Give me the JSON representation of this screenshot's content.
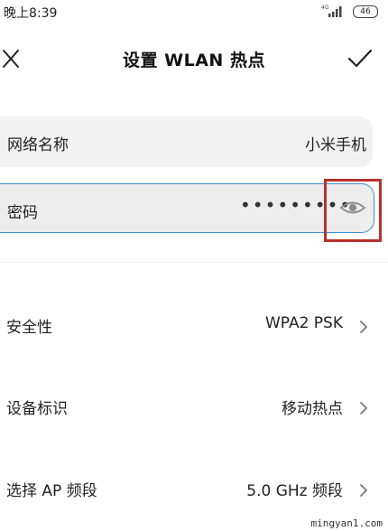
{
  "status_bar": {
    "time": "晚上8:39",
    "network_label": "4G",
    "battery": "46"
  },
  "header": {
    "title": "设置 WLAN 热点",
    "close_icon": "close-icon",
    "confirm_icon": "check-icon"
  },
  "fields": {
    "ssid": {
      "label": "网络名称",
      "value": "小米手机"
    },
    "password": {
      "label": "密码",
      "masked_value": "•••••••••",
      "toggle_icon": "eye-icon"
    }
  },
  "settings": {
    "security": {
      "label": "安全性",
      "value": "WPA2 PSK"
    },
    "device_id": {
      "label": "设备标识",
      "value": "移动热点"
    },
    "band": {
      "label": "选择 AP 频段",
      "value": "5.0 GHz 频段"
    }
  },
  "colors": {
    "focus_border": "#3b8fd9",
    "highlight": "#b9312d",
    "field_bg": "#f2f2f2"
  },
  "watermark": "mingyan1.com"
}
